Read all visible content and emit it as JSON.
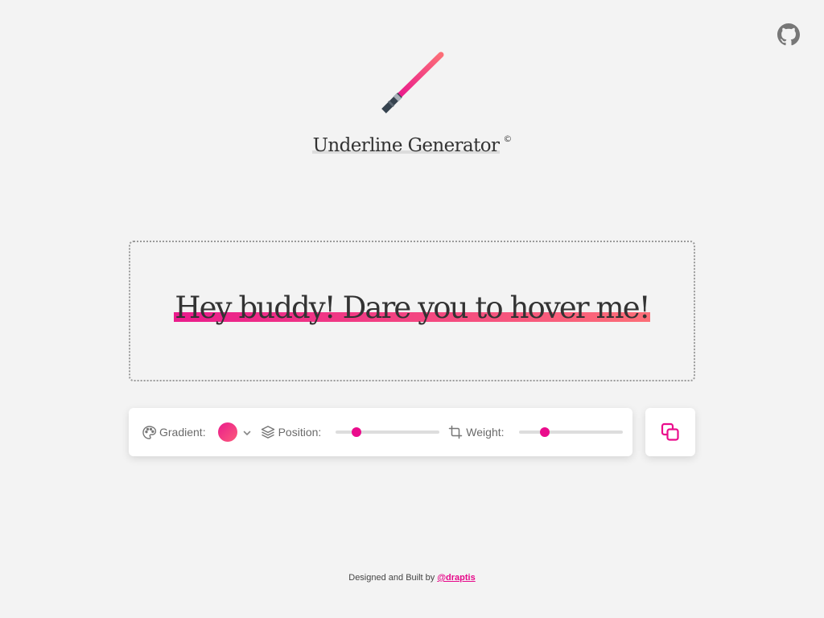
{
  "app": {
    "title": "Underline Generator",
    "title_mark": "©"
  },
  "preview": {
    "text": "Hey buddy! Dare you to hover me!"
  },
  "controls": {
    "gradient_label": "Gradient:",
    "position_label": "Position:",
    "weight_label": "Weight:",
    "position_value": 0.2,
    "weight_value": 0.25,
    "gradient_colors": [
      "#ea1c8c",
      "#fc6e77"
    ]
  },
  "footer": {
    "text": "Designed and Built by",
    "author": "@draptis"
  },
  "icons": {
    "github": "github-icon",
    "logo": "lightsaber-icon",
    "gradient": "palette-icon",
    "position": "layers-icon",
    "weight": "crop-icon",
    "dropdown": "chevron-down-icon",
    "copy": "copy-icon"
  },
  "colors": {
    "accent": "#ea0c8c",
    "background": "#f3f3f3"
  }
}
